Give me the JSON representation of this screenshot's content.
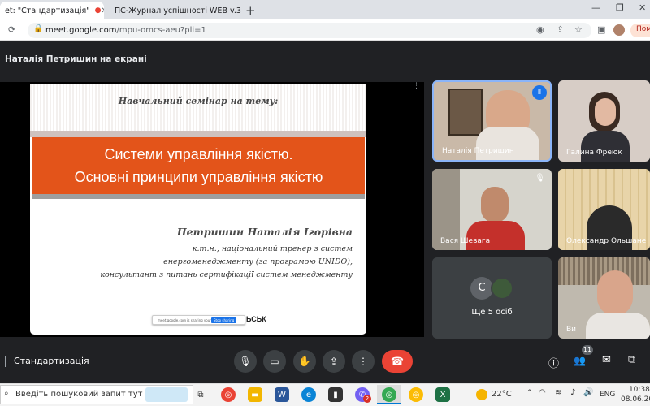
{
  "browser": {
    "tabs": [
      {
        "label": "et: \"Стандартизація\"",
        "active": true
      },
      {
        "label": "ПС-Журнал успішності WEB v.3"
      }
    ],
    "url_host": "meet.google.com",
    "url_path": "/mpu-omcs-aeu?pli=1",
    "profile_button": "Пом"
  },
  "meet": {
    "presenter_label": "Наталія Петришин на екрані",
    "meeting_name": "Стандартизація",
    "participants_count": "11",
    "others_label": "Ще 5 осіб",
    "others_avatar_letter": "С"
  },
  "slide": {
    "header": "Навчальний семінар на тему:",
    "title_line1": "Системи управління якістю.",
    "title_line2": "Основні принципи управління якістю",
    "author": "Петришин Наталія Ігорівна",
    "credentials_line1": "к.т.н., національний тренер з систем",
    "credentials_line2": "енергоменеджменту (за програмою UNIDO),",
    "credentials_line3": "консультант з питань сертифікації систем менеджменту",
    "share_notice": "meet.google.com is sharing your screen",
    "stop_sharing": "Stop sharing",
    "bottom_text": "ЬСЬК"
  },
  "participants": [
    {
      "name": "Наталія Петришин"
    },
    {
      "name": "Галина Фреюк"
    },
    {
      "name": "Вася Шевага"
    },
    {
      "name": "Олександр Ольшане"
    },
    {
      "name": "Ви"
    }
  ],
  "taskbar": {
    "search_placeholder": "Введіть пошуковий запит тут",
    "weather": "22°C",
    "lang": "ENG",
    "time": "10:38",
    "date": "08.06.202",
    "viber_badge": "2"
  },
  "colors": {
    "accent": "#8ab4f8",
    "orange": "#e3541a",
    "end_call": "#ea4335"
  }
}
